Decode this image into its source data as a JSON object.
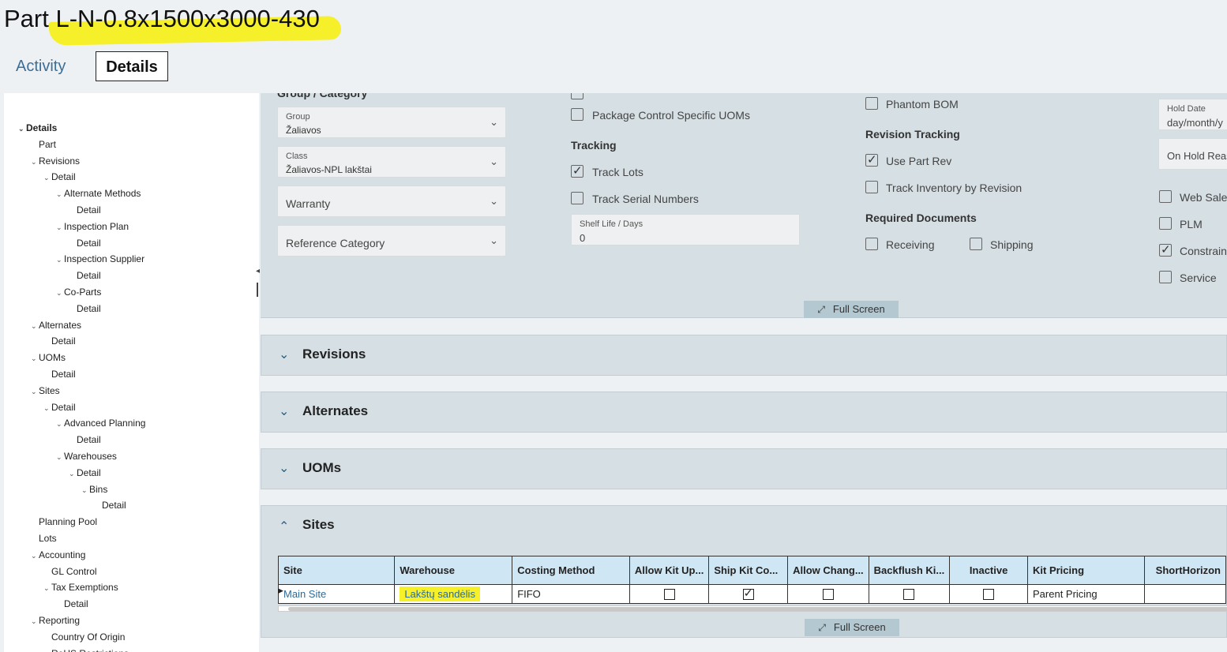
{
  "page": {
    "title": "Part L-N-0.8x1500x3000-430",
    "tabs": [
      "Activity",
      "Details"
    ]
  },
  "tree": [
    {
      "label": "Details",
      "level": 0,
      "chev": true,
      "bold": true
    },
    {
      "label": "Part",
      "level": 1,
      "chev": false
    },
    {
      "label": "Revisions",
      "level": 1,
      "chev": true
    },
    {
      "label": "Detail",
      "level": 2,
      "chev": true
    },
    {
      "label": "Alternate Methods",
      "level": 3,
      "chev": true
    },
    {
      "label": "Detail",
      "level": 4,
      "chev": false
    },
    {
      "label": "Inspection Plan",
      "level": 3,
      "chev": true
    },
    {
      "label": "Detail",
      "level": 4,
      "chev": false
    },
    {
      "label": "Inspection Supplier",
      "level": 3,
      "chev": true
    },
    {
      "label": "Detail",
      "level": 4,
      "chev": false
    },
    {
      "label": "Co-Parts",
      "level": 3,
      "chev": true
    },
    {
      "label": "Detail",
      "level": 4,
      "chev": false
    },
    {
      "label": "Alternates",
      "level": 1,
      "chev": true
    },
    {
      "label": "Detail",
      "level": 2,
      "chev": false
    },
    {
      "label": "UOMs",
      "level": 1,
      "chev": true
    },
    {
      "label": "Detail",
      "level": 2,
      "chev": false
    },
    {
      "label": "Sites",
      "level": 1,
      "chev": true
    },
    {
      "label": "Detail",
      "level": 2,
      "chev": true
    },
    {
      "label": "Advanced Planning",
      "level": 3,
      "chev": true
    },
    {
      "label": "Detail",
      "level": 4,
      "chev": false
    },
    {
      "label": "Warehouses",
      "level": 3,
      "chev": true
    },
    {
      "label": "Detail",
      "level": 4,
      "chev": true
    },
    {
      "label": "Bins",
      "level": 5,
      "chev": true
    },
    {
      "label": "Detail",
      "level": 6,
      "chev": false
    },
    {
      "label": "Planning Pool",
      "level": 1,
      "chev": false
    },
    {
      "label": "Lots",
      "level": 1,
      "chev": false
    },
    {
      "label": "Accounting",
      "level": 1,
      "chev": true
    },
    {
      "label": "GL Control",
      "level": 2,
      "chev": false
    },
    {
      "label": "Tax Exemptions",
      "level": 2,
      "chev": true
    },
    {
      "label": "Detail",
      "level": 3,
      "chev": false
    },
    {
      "label": "Reporting",
      "level": 1,
      "chev": true
    },
    {
      "label": "Country Of Origin",
      "level": 2,
      "chev": false
    },
    {
      "label": "RoHS Restrictions",
      "level": 2,
      "chev": true
    }
  ],
  "group_category": {
    "heading": "Group / Category",
    "group_label": "Group",
    "group_value": "Žaliavos",
    "class_label": "Class",
    "class_value": "Žaliavos-NPL lakštai",
    "warranty": "Warranty",
    "reference_category": "Reference Category"
  },
  "uom_tracking": {
    "package_control": {
      "label": "Package Control Specific UOMs",
      "checked": false
    },
    "tracking_heading": "Tracking",
    "track_lots": {
      "label": "Track Lots",
      "checked": true
    },
    "track_serial": {
      "label": "Track Serial Numbers",
      "checked": false
    },
    "shelf_life_label": "Shelf Life / Days",
    "shelf_life_value": "0"
  },
  "revision": {
    "phantom_bom": {
      "label": "Phantom BOM",
      "checked": false
    },
    "heading": "Revision Tracking",
    "use_part_rev": {
      "label": "Use Part Rev",
      "checked": true
    },
    "track_inventory": {
      "label": "Track Inventory by Revision",
      "checked": false
    },
    "required_docs_heading": "Required Documents",
    "receiving": {
      "label": "Receiving",
      "checked": false
    },
    "shipping": {
      "label": "Shipping",
      "checked": false
    }
  },
  "right_col": {
    "hold_date_label": "Hold Date",
    "hold_date_value": "day/month/y",
    "on_hold_reason": "On Hold Reas",
    "web_saleable": {
      "label": "Web Salea",
      "checked": false
    },
    "plm": {
      "label": "PLM",
      "checked": false
    },
    "constrained": {
      "label": "Constraine",
      "checked": true
    },
    "service": {
      "label": "Service",
      "checked": false
    }
  },
  "full_screen_label": "Full Screen",
  "panels": {
    "revisions": "Revisions",
    "alternates": "Alternates",
    "uoms": "UOMs",
    "sites": "Sites"
  },
  "sites_grid": {
    "columns": [
      "Site",
      "Warehouse",
      "Costing Method",
      "Allow Kit Up...",
      "Ship Kit Co...",
      "Allow Chang...",
      "Backflush Ki...",
      "Inactive",
      "Kit Pricing",
      "ShortHorizon"
    ],
    "row": {
      "site": "Main Site",
      "warehouse": "Lakštų sandėlis",
      "costing_method": "FIFO",
      "allow_kit_update": false,
      "ship_kit_components": true,
      "allow_change": false,
      "backflush_kit": false,
      "inactive": false,
      "kit_pricing": "Parent Pricing",
      "short_horizon": ""
    }
  }
}
